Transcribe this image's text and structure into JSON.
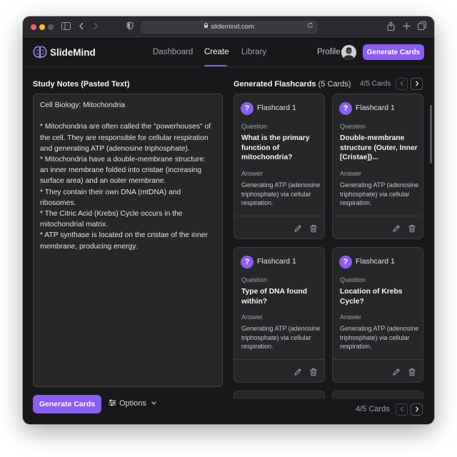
{
  "browser": {
    "url": "slidemind.com"
  },
  "app": {
    "brand": "SlideMind",
    "nav": [
      "Dashboard",
      "Create",
      "Library"
    ],
    "active_nav": "Create",
    "profile_label": "Profile",
    "header_button": "Generate Cards",
    "accent_color": "#8b5cf6"
  },
  "notes": {
    "section_title": "Study Notes (Pasted Text)",
    "text": "Cell Biology: Mitochondria\n\n* Mitochondria are often called the \"powerhouses\" of the cell. They are responsible for cellular respiration and generating ATP (adenosine triphosphate).\n* Mitochondria have a double-membrane structure: an inner membrane folded into cristae (increasing surface area) and an outer membrane.\n* They contain their own DNA (mtDNA) and ribosomes.\n* The Citric Acid (Krebs) Cycle occurs in the mitochondrial matrix.\n* ATP synthase is located on the cristae of the inner membrane, producing energy.",
    "generate_button": "Generate Cards",
    "options_label": "Options"
  },
  "flashcards": {
    "section_title": "Generated Flashcards",
    "count_label": "(5 Cards)",
    "top_counter": "4/5 Cards",
    "bottom_counter": "4/5 Cards",
    "question_label": "Question",
    "answer_label": "Answer",
    "cards": [
      {
        "title": "Flashcard 1",
        "question": "What is the primary function of mitochondria?",
        "answer": "Generating ATP (adenosine triphosphate) via cellular respiration."
      },
      {
        "title": "Flashcard 1",
        "question": "Double-membrane structure (Outer, Inner [Cristae])...",
        "answer": "Generating ATP (adenosine triphosphate) via cellular respiration."
      },
      {
        "title": "Flashcard 1",
        "question": "Type of DNA found within?",
        "answer": "Generating ATP (adenosine triphosphate) via cellular respiration."
      },
      {
        "title": "Flashcard 1",
        "question": "Location of Krebs Cycle?",
        "answer": "Generating ATP (adenosine triphosphate) via cellular respiration."
      }
    ]
  }
}
